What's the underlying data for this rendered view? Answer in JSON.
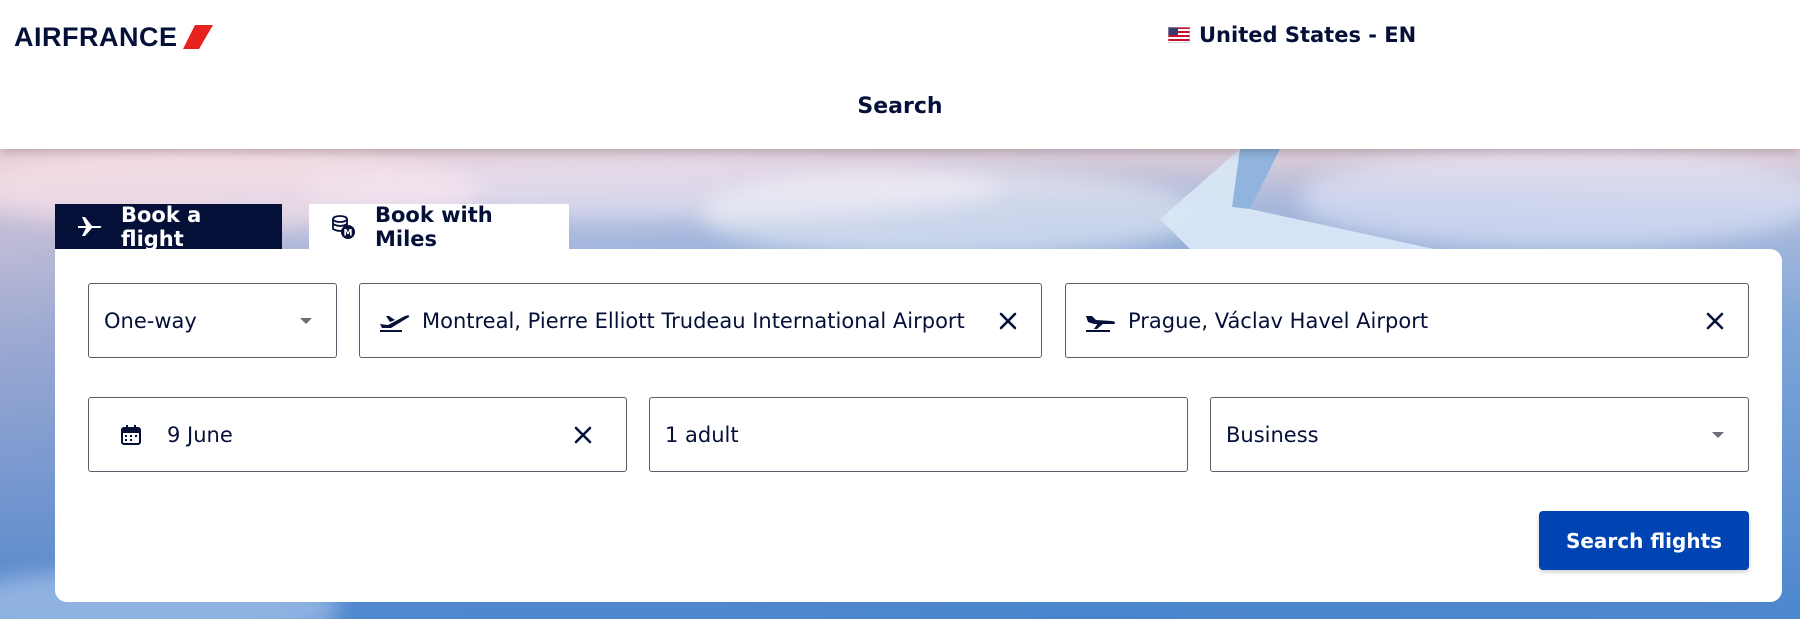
{
  "brand": {
    "name": "AIRFRANCE",
    "accent_color": "#e6211e",
    "logo_icon": "airfrance-slash-logo"
  },
  "header": {
    "locale_flag_icon": "us-flag-icon",
    "locale_label": "United States - EN",
    "nav_search_label": "Search"
  },
  "tabs": [
    {
      "label": "Book a flight",
      "icon": "plane-icon",
      "active": true
    },
    {
      "label": "Book with Miles",
      "icon": "miles-coins-icon",
      "active": false
    }
  ],
  "form": {
    "trip_type": {
      "value": "One-way",
      "icon": "chevron-down-icon"
    },
    "origin": {
      "value": "Montreal, Pierre Elliott Trudeau International Airport",
      "icon": "plane-takeoff-icon"
    },
    "destination": {
      "value": "Prague, Václav Havel Airport",
      "icon": "plane-landing-icon"
    },
    "date": {
      "value": "9 June",
      "icon": "calendar-icon"
    },
    "passengers": {
      "value": "1 adult"
    },
    "cabin": {
      "value": "Business",
      "icon": "chevron-down-icon"
    },
    "search_button_label": "Search flights"
  },
  "colors": {
    "navy": "#051039",
    "primary_button": "#0043b2",
    "tab_active_bg": "#051039"
  }
}
